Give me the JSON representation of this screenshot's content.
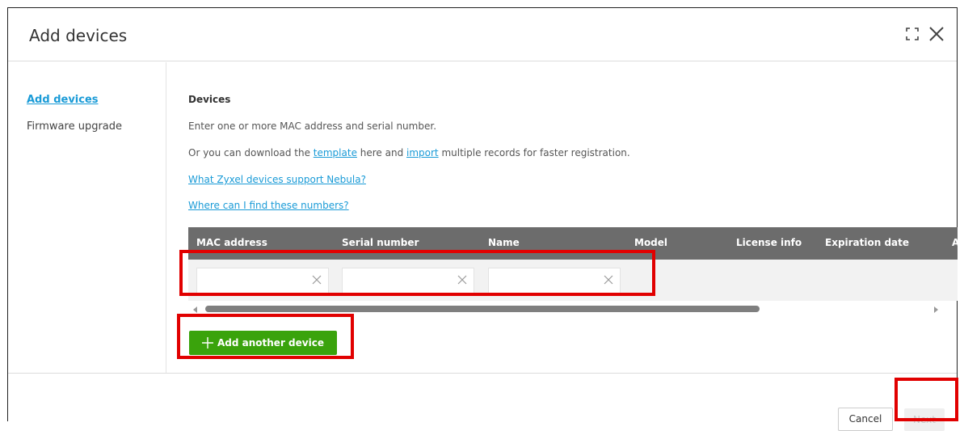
{
  "dialog": {
    "title": "Add devices"
  },
  "sidebar": {
    "items": [
      {
        "label": "Add devices",
        "active": true
      },
      {
        "label": "Firmware upgrade",
        "active": false
      }
    ]
  },
  "main": {
    "section_title": "Devices",
    "instruction": "Enter one or more MAC address and serial number.",
    "download_prefix": "Or you can download the ",
    "template_link": "template",
    "download_middle": " here and ",
    "import_link": "import",
    "download_suffix": " multiple records for faster registration.",
    "supported_link": "What Zyxel devices support Nebula?",
    "find_numbers_link": "Where can I find these numbers?"
  },
  "table": {
    "columns": [
      "MAC address",
      "Serial number",
      "Name",
      "Model",
      "License info",
      "Expiration date",
      "A"
    ],
    "row": {
      "mac_value": "",
      "serial_value": "",
      "name_value": ""
    }
  },
  "actions": {
    "add_device_label": "Add another device",
    "cancel_label": "Cancel",
    "next_label": "Next"
  },
  "colors": {
    "accent_link": "#1a9bd7",
    "add_button": "#3aa30c",
    "header_bg": "#6c6c6c",
    "annotation": "#e10000"
  }
}
